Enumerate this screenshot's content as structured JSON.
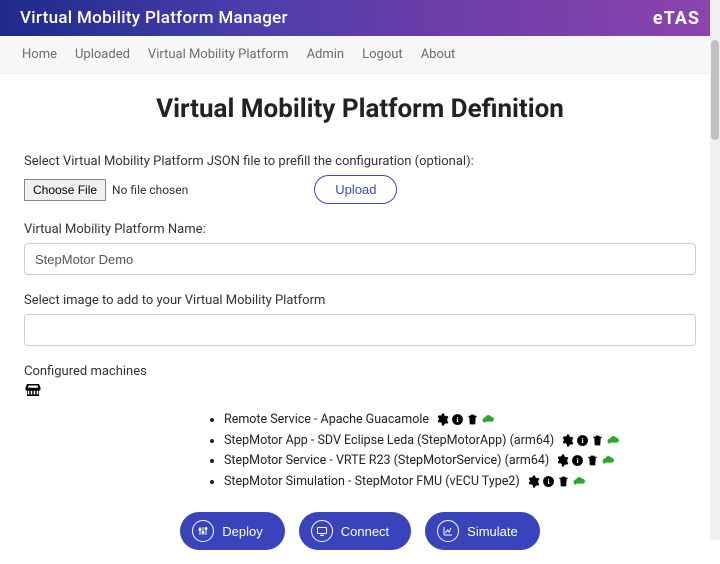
{
  "titlebar": {
    "title": "Virtual Mobility Platform Manager",
    "logo": "eTAS"
  },
  "nav": {
    "items": [
      "Home",
      "Uploaded",
      "Virtual Mobility Platform",
      "Admin",
      "Logout",
      "About"
    ]
  },
  "page": {
    "title": "Virtual Mobility Platform Definition",
    "json_label": "Select Virtual Mobility Platform JSON file to prefill the configuration (optional):",
    "choose_file": "Choose File",
    "file_status": "No file chosen",
    "upload": "Upload",
    "name_label": "Virtual Mobility Platform Name:",
    "name_value": "StepMotor Demo",
    "image_label": "Select image to add to your Virtual Mobility Platform",
    "image_value": "",
    "machines_label": "Configured machines"
  },
  "machines": [
    {
      "text": "Remote Service - Apache Guacamole"
    },
    {
      "text": "StepMotor App - SDV Eclipse Leda (StepMotorApp) (arm64)"
    },
    {
      "text": "StepMotor Service - VRTE R23 (StepMotorService) (arm64)"
    },
    {
      "text": "StepMotor Simulation - StepMotor FMU (vECU Type2)"
    }
  ],
  "actions": {
    "deploy": "Deploy",
    "connect": "Connect",
    "simulate": "Simulate"
  }
}
